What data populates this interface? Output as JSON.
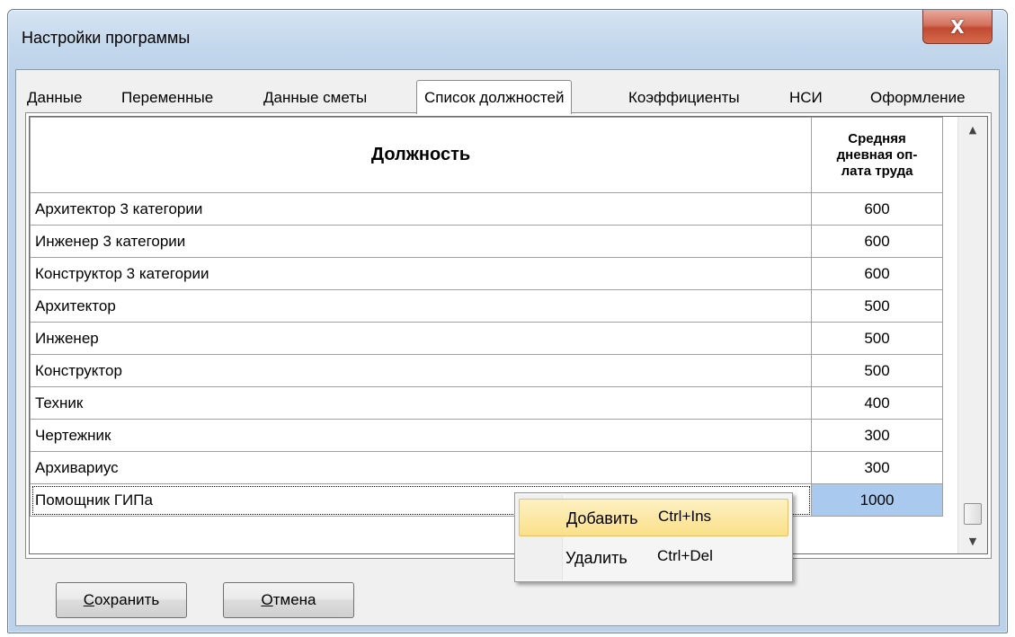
{
  "window": {
    "title": "Настройки программы",
    "close_glyph": "X"
  },
  "tabs": [
    {
      "label": "Данные",
      "active": false
    },
    {
      "label": "Переменные",
      "active": false
    },
    {
      "label": "Данные сметы",
      "active": false
    },
    {
      "label": "Список должностей",
      "active": true
    },
    {
      "label": "Коэффициенты",
      "active": false
    },
    {
      "label": "НСИ",
      "active": false
    },
    {
      "label": "Оформление",
      "active": false
    }
  ],
  "grid": {
    "headers": {
      "position": "Должность",
      "rate_line1": "Средняя",
      "rate_line2": "дневная оп-",
      "rate_line3": "лата труда"
    },
    "rows": [
      {
        "position": "Архитектор 3 категории",
        "rate": "600"
      },
      {
        "position": "Инженер 3 категории",
        "rate": "600"
      },
      {
        "position": "Конструктор 3 категории",
        "rate": "600"
      },
      {
        "position": "Архитектор",
        "rate": "500"
      },
      {
        "position": "Инженер",
        "rate": "500"
      },
      {
        "position": "Конструктор",
        "rate": "500"
      },
      {
        "position": "Техник",
        "rate": "400"
      },
      {
        "position": "Чертежник",
        "rate": "300"
      },
      {
        "position": "Архивариус",
        "rate": "300"
      },
      {
        "position": "Помощник ГИПа",
        "rate": "1000",
        "selected": true
      }
    ]
  },
  "context_menu": {
    "items": [
      {
        "label": "Добавить",
        "shortcut": "Ctrl+Ins"
      },
      {
        "label": "Удалить",
        "shortcut": "Ctrl+Del"
      }
    ]
  },
  "buttons": {
    "save_accel": "С",
    "save_rest": "охранить",
    "cancel_accel": "О",
    "cancel_rest": "тмена"
  },
  "icons": {
    "scroll_up": "up-arrow-icon",
    "scroll_down": "down-arrow-icon"
  }
}
